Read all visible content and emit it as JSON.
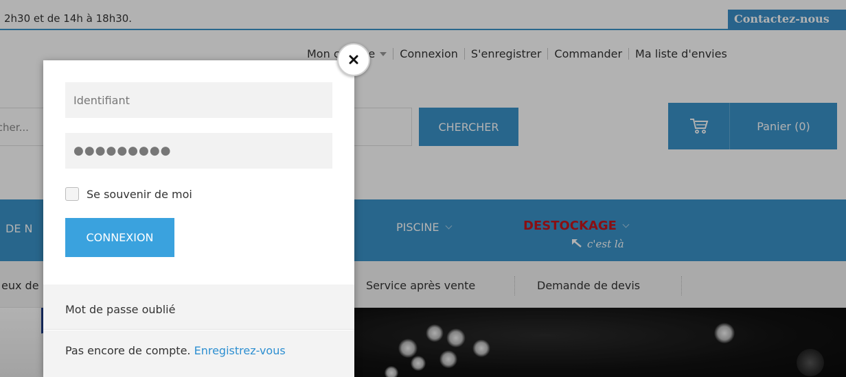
{
  "topbar": {
    "hours_text": "2h30 et de 14h à 18h30.",
    "contact_label": "Contactez-nous"
  },
  "account_nav": {
    "my_account": "Mon compte",
    "login": "Connexion",
    "register": "S'enregistrer",
    "order": "Commander",
    "wishlist": "Ma liste d'envies"
  },
  "search": {
    "placeholder": "Rechercher...",
    "button_label": "CHERCHER"
  },
  "cart": {
    "icon": "cart-icon",
    "label": "Panier (0)"
  },
  "main_nav": {
    "items": [
      {
        "label": "DE N"
      },
      {
        "label": "PISCINE"
      },
      {
        "label": "DESTOCKAGE"
      }
    ],
    "destock_tagline": "c'est là"
  },
  "sub_nav": {
    "items": [
      {
        "label": "eux de"
      },
      {
        "label": "Service après vente"
      },
      {
        "label": "Demande de devis"
      }
    ]
  },
  "login_modal": {
    "username_placeholder": "Identifiant",
    "password_value": "●●●●●●●●●",
    "remember_label": "Se souvenir de moi",
    "submit_label": "CONNEXION",
    "forgot_label": "Mot de passe oublié",
    "no_account_text": "Pas encore de compte.",
    "register_link": "Enregistrez-vous",
    "close_icon": "close-icon"
  },
  "colors": {
    "brand_blue": "#3a93c9",
    "button_blue": "#3aa2de",
    "link_blue": "#2d8fd1",
    "destock_red": "#c4161c"
  }
}
